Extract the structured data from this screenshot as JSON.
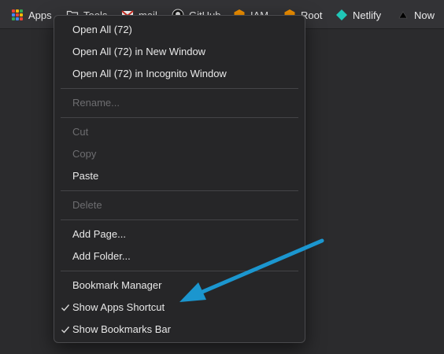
{
  "bookmarks_bar": {
    "items": [
      {
        "label": "Apps"
      },
      {
        "label": "Tools"
      },
      {
        "label": "mail"
      },
      {
        "label": "GitHub"
      },
      {
        "label": "IAM"
      },
      {
        "label": "Root"
      },
      {
        "label": "Netlify"
      },
      {
        "label": "Now"
      }
    ]
  },
  "context_menu": {
    "open_all": "Open All (72)",
    "open_all_new_window": "Open All (72) in New Window",
    "open_all_incognito": "Open All (72) in Incognito Window",
    "rename": "Rename...",
    "cut": "Cut",
    "copy": "Copy",
    "paste": "Paste",
    "delete": "Delete",
    "add_page": "Add Page...",
    "add_folder": "Add Folder...",
    "bookmark_manager": "Bookmark Manager",
    "show_apps_shortcut": "Show Apps Shortcut",
    "show_bookmarks_bar": "Show Bookmarks Bar"
  },
  "colors": {
    "annotation_arrow": "#1b96cf",
    "netlify": "#20c6b7",
    "aws_orange": "#f29100",
    "gmail_red": "#d93025"
  },
  "icons": {
    "apps": "apps-grid-icon",
    "tools": "folder-icon",
    "mail": "gmail-icon",
    "github": "github-icon",
    "iam": "aws-icon",
    "root": "aws-icon",
    "netlify": "netlify-icon",
    "now": "now-icon",
    "checkmark": "checkmark-icon"
  }
}
